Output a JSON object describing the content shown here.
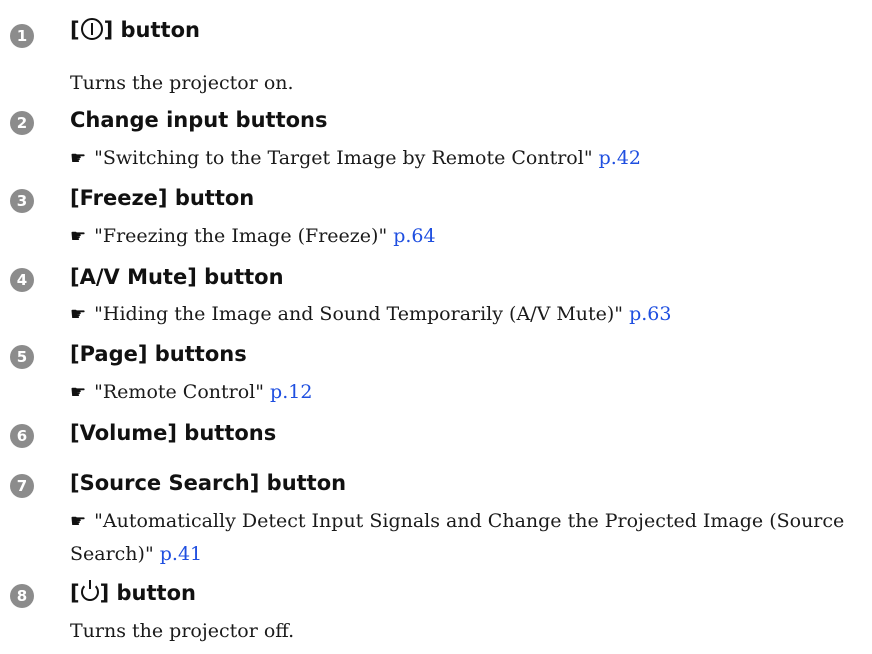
{
  "items": [
    {
      "number": "1",
      "heading_prefix": "[",
      "heading_suffix": "] button",
      "icon": "power-on-icon",
      "description": "Turns the projector on."
    },
    {
      "number": "2",
      "heading": "Change input buttons",
      "ref_text": "\"Switching to the Target Image by Remote Control\"",
      "ref_page": "p.42"
    },
    {
      "number": "3",
      "heading": "[Freeze] button",
      "ref_text": "\"Freezing the Image (Freeze)\"",
      "ref_page": "p.64"
    },
    {
      "number": "4",
      "heading": "[A/V Mute] button",
      "ref_text": "\"Hiding the Image and Sound Temporarily (A/V Mute)\"",
      "ref_page": "p.63"
    },
    {
      "number": "5",
      "heading": "[Page] buttons",
      "ref_text": "\"Remote Control\"",
      "ref_page": "p.12"
    },
    {
      "number": "6",
      "heading": "[Volume] buttons"
    },
    {
      "number": "7",
      "heading": "[Source Search] button",
      "ref_text": "\"Automatically Detect Input Signals and Change the Projected Image (Source Search)\"",
      "ref_page": "p.41"
    },
    {
      "number": "8",
      "heading_prefix": "[",
      "heading_suffix": "] button",
      "icon": "standby-icon",
      "description": "Turns the projector off."
    }
  ],
  "ref_icon": "pointing-hand-icon",
  "colors": {
    "number_badge": "#8c8c8c",
    "link": "#1f4fe0",
    "text": "#1a1a1a"
  }
}
